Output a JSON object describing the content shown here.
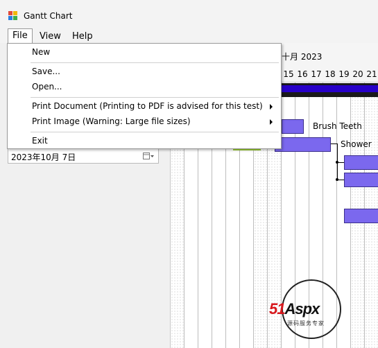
{
  "window": {
    "title": "Gantt Chart"
  },
  "menubar": {
    "items": [
      "File",
      "View",
      "Help"
    ]
  },
  "file_menu": {
    "items": [
      {
        "label": "New"
      },
      {
        "label": "Save..."
      },
      {
        "label": "Open..."
      },
      {
        "label": "Print Document (Printing to PDF is advised for this test)",
        "submenu": true
      },
      {
        "label": "Print Image (Warning: Large file sizes)",
        "submenu": true
      },
      {
        "label": "Exit"
      }
    ]
  },
  "left_panel": {
    "date_value": "2023年10月  7日"
  },
  "chart": {
    "month_label": "十月 2023",
    "days": [
      "15",
      "16",
      "17",
      "18",
      "19",
      "20",
      "21"
    ],
    "task_labels": {
      "brush_teeth": "Brush Teeth",
      "shower": "Shower"
    },
    "colors": {
      "bar": "#7b68ee",
      "band": "#2800c9",
      "accent": "#9acd32"
    }
  },
  "watermark": {
    "brand": "51Aspx",
    "sub": "源码服务专家"
  }
}
